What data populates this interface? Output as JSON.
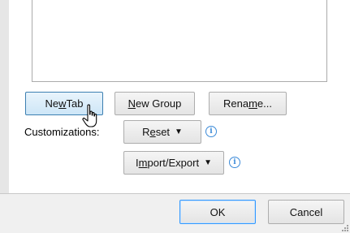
{
  "buttons": {
    "new_tab": {
      "pre": "Ne",
      "u": "w",
      "post": " Tab"
    },
    "new_group": {
      "pre": "",
      "u": "N",
      "post": "ew Group"
    },
    "rename": {
      "pre": "Rena",
      "u": "m",
      "post": "e..."
    },
    "reset": {
      "pre": "R",
      "u": "e",
      "post": "set"
    },
    "import_export": {
      "pre": "I",
      "u": "m",
      "post": "port/Export"
    },
    "ok": "OK",
    "cancel": "Cancel"
  },
  "customizations_label": "Customizations:",
  "info_glyph": "i",
  "dropdown_glyph": "▼",
  "icons": {
    "info": "info-icon",
    "cursor": "mouse-pointer-icon",
    "dropdown": "caret-down-icon",
    "grip": "resize-grip-icon"
  }
}
